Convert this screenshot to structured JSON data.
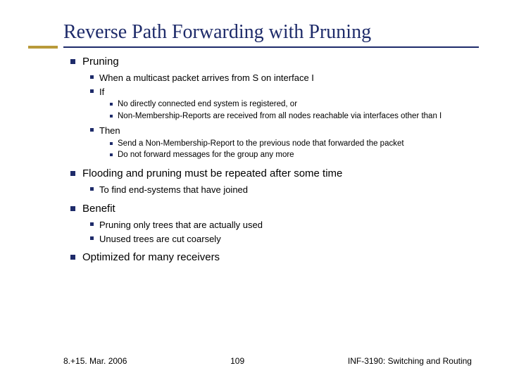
{
  "title": "Reverse Path Forwarding with Pruning",
  "bullets": [
    {
      "text": "Pruning",
      "children": [
        {
          "text": "When a multicast packet arrives from S on interface I"
        },
        {
          "text": "If",
          "children": [
            {
              "text": "No directly connected end system is registered, or"
            },
            {
              "text": "Non-Membership-Reports are received from all nodes reachable via interfaces other than I"
            }
          ]
        },
        {
          "text": "Then",
          "children": [
            {
              "text": "Send a Non-Membership-Report to the previous node that forwarded the packet"
            },
            {
              "text": "Do not forward messages for the group any more"
            }
          ]
        }
      ]
    },
    {
      "text": "Flooding and pruning must be repeated after some time",
      "children": [
        {
          "text": "To find end-systems that have joined"
        }
      ]
    },
    {
      "text": "Benefit",
      "children": [
        {
          "text": "Pruning only trees that are actually used"
        },
        {
          "text": "Unused trees are cut coarsely"
        }
      ]
    },
    {
      "text": "Optimized for many receivers"
    }
  ],
  "footer": {
    "left": "8.+15. Mar. 2006",
    "center": "109",
    "right": "INF-3190: Switching and Routing"
  }
}
